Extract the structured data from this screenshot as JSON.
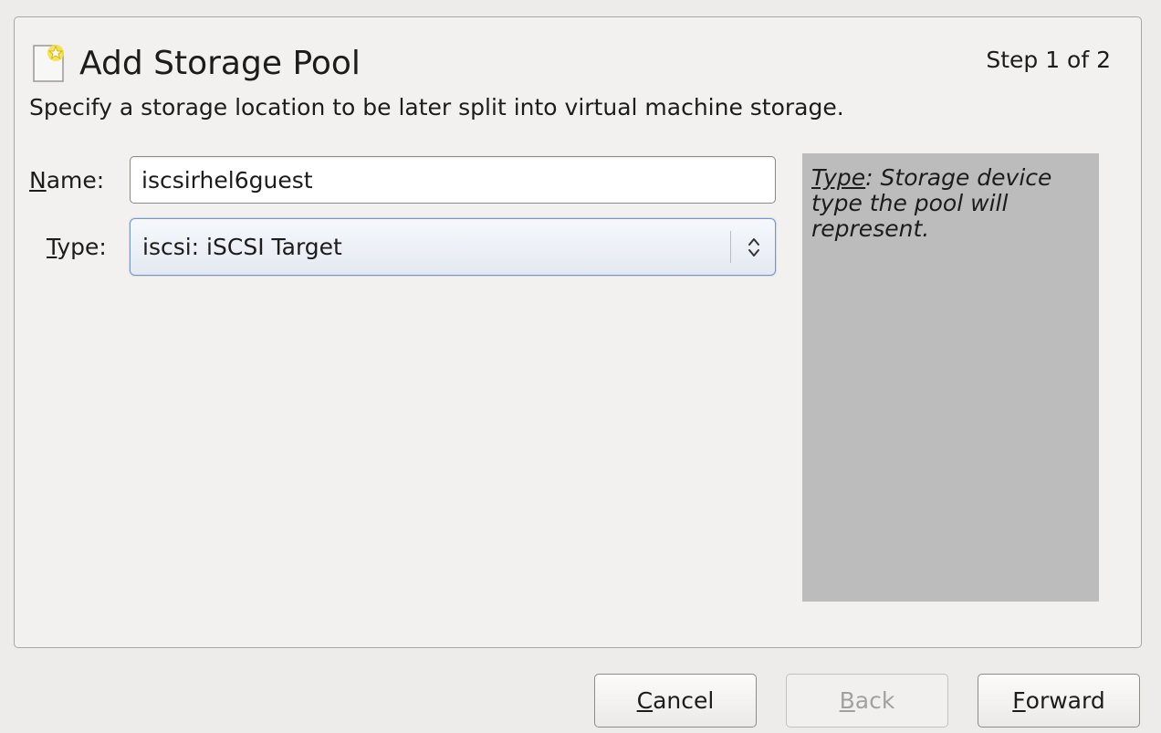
{
  "header": {
    "title": "Add Storage Pool",
    "step": "Step 1 of 2",
    "subtitle": "Specify a storage location to be later split into virtual machine storage.",
    "icon": "new-document-star-icon"
  },
  "form": {
    "name_label_mnemonic": "N",
    "name_label_rest": "ame:",
    "name_value": "iscsirhel6guest",
    "type_label_mnemonic": "T",
    "type_label_rest": "ype:",
    "type_value": "iscsi: iSCSI Target"
  },
  "help": {
    "keyword": "Type",
    "text": ": Storage device type the pool will represent."
  },
  "buttons": {
    "cancel_mnemonic": "C",
    "cancel_rest": "ancel",
    "back_mnemonic": "B",
    "back_rest": "ack",
    "forward_mnemonic": "F",
    "forward_rest": "orward"
  },
  "colors": {
    "panel_bg": "#f2f1f0",
    "help_bg": "#bcbcbc",
    "select_border": "#7996c4"
  }
}
